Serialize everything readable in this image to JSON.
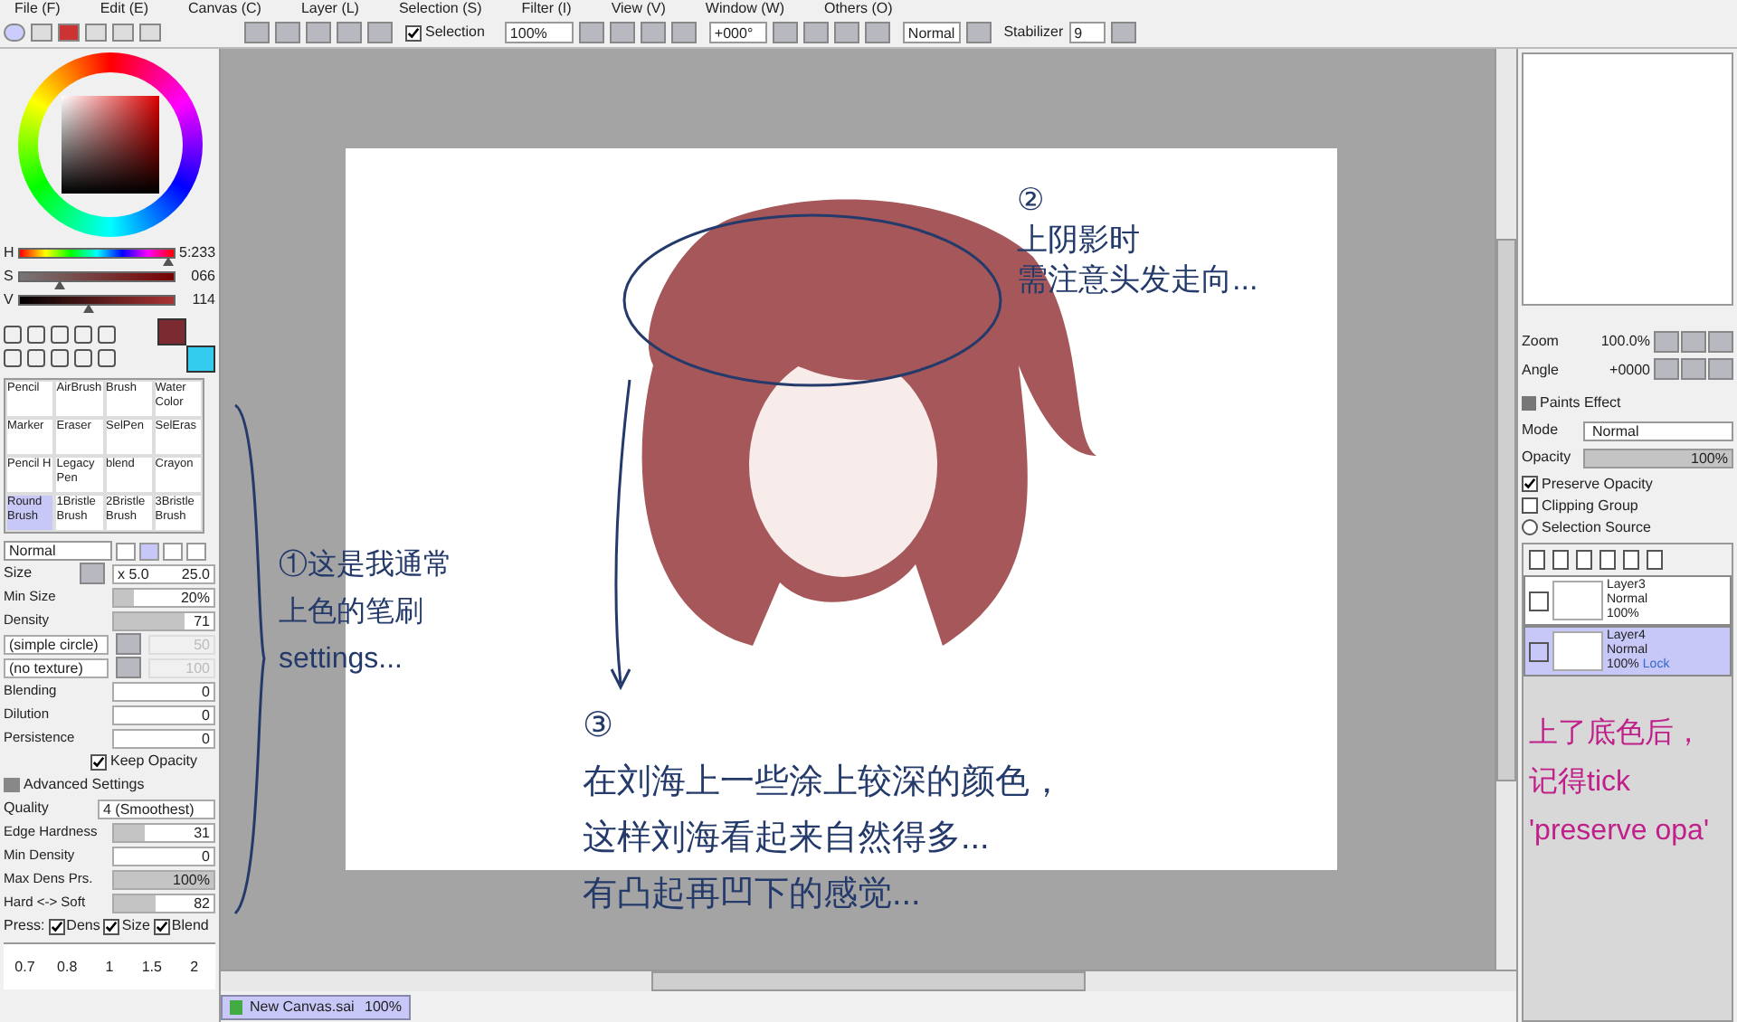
{
  "menu": [
    "File (F)",
    "Edit (E)",
    "Canvas (C)",
    "Layer (L)",
    "Selection (S)",
    "Filter (I)",
    "View (V)",
    "Window (W)",
    "Others (O)"
  ],
  "toolbar": {
    "selection": {
      "label": "Selection",
      "checked": true
    },
    "zoom": "100%",
    "angle": "+000°",
    "mode": "Normal",
    "stabilizer_label": "Stabilizer",
    "stabilizer": "9"
  },
  "color": {
    "sliders": [
      {
        "label": "H",
        "reading": "5:233",
        "level": 0.97
      },
      {
        "label": "S",
        "reading": "066",
        "level": 0.26
      },
      {
        "label": "V",
        "reading": "114",
        "level": 0.45
      }
    ]
  },
  "brushes": [
    {
      "name": "Pencil",
      "selected": false
    },
    {
      "name": "AirBrush",
      "selected": false
    },
    {
      "name": "Brush",
      "selected": false
    },
    {
      "name": "Water Color",
      "selected": false
    },
    {
      "name": "Marker",
      "selected": false
    },
    {
      "name": "Eraser",
      "selected": false
    },
    {
      "name": "SelPen",
      "selected": false
    },
    {
      "name": "SelEras",
      "selected": false
    },
    {
      "name": "Pencil H",
      "selected": false
    },
    {
      "name": "Legacy Pen",
      "selected": false
    },
    {
      "name": "blend",
      "selected": false
    },
    {
      "name": "Crayon",
      "selected": false
    },
    {
      "name": "Round Brush",
      "selected": true
    },
    {
      "name": "1Bristle Brush",
      "selected": false
    },
    {
      "name": "2Bristle Brush",
      "selected": false
    },
    {
      "name": "3Bristle Brush",
      "selected": false
    }
  ],
  "brush_settings": {
    "blend_mode": "Normal",
    "size": {
      "label": "Size",
      "multiplier": "x 5.0",
      "value": "25.0"
    },
    "rows": [
      {
        "kind": "bar",
        "label": "Min Size",
        "value": "20%",
        "level": 0.2
      },
      {
        "kind": "bar",
        "label": "Density",
        "value": "71",
        "level": 0.71
      },
      {
        "kind": "dropdown",
        "label": "(simple circle)",
        "value": "50"
      },
      {
        "kind": "dropdown",
        "label": "(no texture)",
        "value": "100"
      },
      {
        "kind": "bar",
        "label": "Blending",
        "value": "0",
        "level": 0
      },
      {
        "kind": "bar",
        "label": "Dilution",
        "value": "0",
        "level": 0
      },
      {
        "kind": "bar",
        "label": "Persistence",
        "value": "0",
        "level": 0
      },
      {
        "kind": "check",
        "label": "Keep Opacity",
        "checked": true
      },
      {
        "kind": "header",
        "label": "Advanced Settings"
      },
      {
        "kind": "select",
        "label": "Quality",
        "value": "4 (Smoothest)"
      },
      {
        "kind": "bar",
        "label": "Edge Hardness",
        "value": "31",
        "level": 0.31
      },
      {
        "kind": "bar",
        "label": "Min Density",
        "value": "0",
        "level": 0
      },
      {
        "kind": "bar",
        "label": "Max Dens Prs.",
        "value": "100%",
        "level": 1
      },
      {
        "kind": "bar",
        "label": "Hard <-> Soft",
        "value": "82",
        "level": 0.41
      }
    ],
    "press": {
      "label": "Press:",
      "options": [
        {
          "label": "Dens",
          "checked": true
        },
        {
          "label": "Size",
          "checked": true
        },
        {
          "label": "Blend",
          "checked": true
        }
      ]
    },
    "size_presets": [
      "0.7",
      "0.8",
      "1",
      "1.5",
      "2"
    ]
  },
  "navigator": {
    "zoom_label": "Zoom",
    "zoom": "100.0%",
    "angle_label": "Angle",
    "angle": "+0000"
  },
  "layer_panel": {
    "paints_effect": "Paints Effect",
    "mode_label": "Mode",
    "mode": "Normal",
    "opacity_label": "Opacity",
    "opacity": {
      "value": "100%",
      "level": 1
    },
    "options": [
      {
        "kind": "check",
        "label": "Preserve Opacity",
        "checked": true
      },
      {
        "kind": "check",
        "label": "Clipping Group",
        "checked": false
      },
      {
        "kind": "radio",
        "label": "Selection Source",
        "checked": false
      }
    ],
    "layers": [
      {
        "name": "Layer3",
        "mode": "Normal",
        "opacity": "100%",
        "selected": false
      },
      {
        "name": "Layer4",
        "mode": "Normal",
        "opacity": "100%",
        "lock": "Lock",
        "selected": true
      }
    ]
  },
  "annotations": [
    {
      "color": "#243a6b",
      "lines": [
        "①这是我通常",
        "上色的笔刷",
        "settings..."
      ]
    },
    {
      "color": "#243a6b",
      "lines": [
        "②",
        "上阴影时",
        "需注意头发走向..."
      ]
    },
    {
      "color": "#243a6b",
      "lines": [
        "③",
        "在刘海上一些涂上较深的颜色，",
        "这样刘海看起来自然得多...",
        "有凸起再凹下的感觉..."
      ]
    },
    {
      "color": "#c0208a",
      "lines": [
        "上了底色后，",
        "记得tick",
        "'preserve opa'"
      ]
    }
  ],
  "status_bar": {
    "file": "New Canvas.sai",
    "zoom": "100%"
  }
}
